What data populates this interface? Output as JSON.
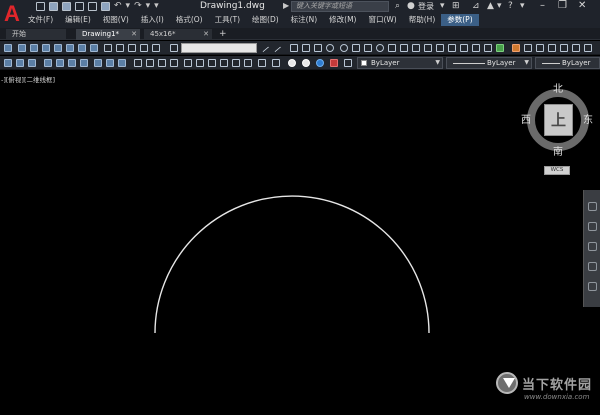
{
  "title_bar": {
    "app_logo": "A",
    "doc_title": "Drawing1.dwg",
    "search_placeholder": "键入关键字或短语",
    "login_label": "登录"
  },
  "menu": {
    "items": [
      "文件(F)",
      "编辑(E)",
      "视图(V)",
      "插入(I)",
      "格式(O)",
      "工具(T)",
      "绘图(D)",
      "标注(N)",
      "修改(M)",
      "窗口(W)",
      "帮助(H)",
      "参数(P)"
    ],
    "active_index": 11
  },
  "tabs": [
    {
      "label": "开始",
      "active": false,
      "closable": false
    },
    {
      "label": "Drawing1*",
      "active": true,
      "closable": true
    },
    {
      "label": "45x16*",
      "active": false,
      "closable": true
    }
  ],
  "tab_add_label": "+",
  "properties": {
    "color": "ByLayer",
    "linetype": "ByLayer",
    "lineweight": "ByLayer"
  },
  "viewport": {
    "label": "-][俯视][二维线框]"
  },
  "viewcube": {
    "face": "上",
    "north": "北",
    "south": "南",
    "east": "东",
    "west": "西",
    "wcs": "WCS"
  },
  "watermark": {
    "name": "当下软件园",
    "url": "www.downxia.com"
  },
  "colors": {
    "accent": "#3b5f86",
    "logo": "#e0262b",
    "background": "#000000"
  }
}
